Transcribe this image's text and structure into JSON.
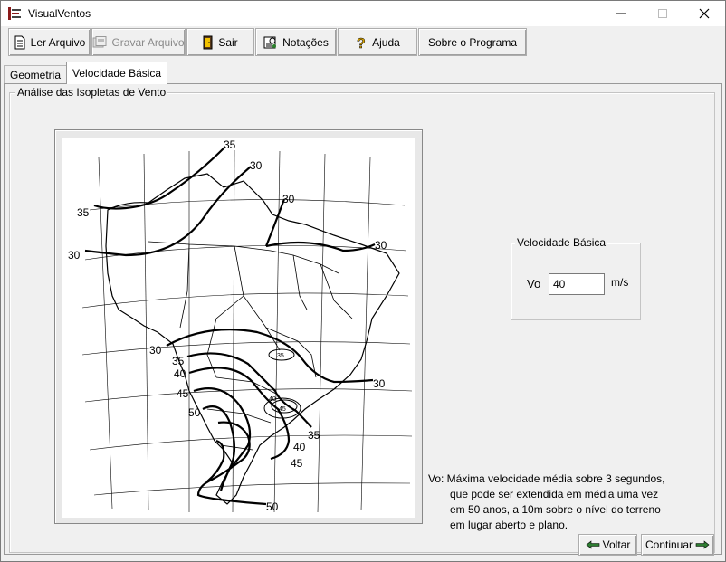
{
  "window": {
    "title": "VisualVentos"
  },
  "toolbar": {
    "buttons": [
      {
        "label": "Ler Arquivo",
        "icon": "document-icon",
        "enabled": true
      },
      {
        "label": "Gravar Arquivo",
        "icon": "save-icon",
        "enabled": false
      },
      {
        "label": "Sair",
        "icon": "exit-door-icon",
        "enabled": true
      },
      {
        "label": "Notações",
        "icon": "notes-icon",
        "enabled": true
      },
      {
        "label": "Ajuda",
        "icon": "help-icon",
        "enabled": true
      },
      {
        "label": "Sobre o Programa",
        "icon": "",
        "enabled": true
      }
    ]
  },
  "tabs": [
    {
      "label": "Geometria",
      "active": false
    },
    {
      "label": "Velocidade Básica",
      "active": true
    }
  ],
  "analysis_group": {
    "title": "Análise das Isopletas de Vento"
  },
  "map": {
    "isopleth_labels": [
      "35",
      "30",
      "35",
      "30",
      "30",
      "30",
      "30",
      "35",
      "40",
      "45",
      "50",
      "35",
      "40",
      "45",
      "50",
      "30",
      "35",
      "40",
      "45"
    ]
  },
  "velocity_group": {
    "title": "Velocidade Básica",
    "field_label": "Vo",
    "value": "40",
    "unit": "m/s"
  },
  "note": {
    "lines": [
      "Vo: Máxima velocidade média sobre 3 segundos,",
      "que pode ser extendida em média uma vez",
      "em 50 anos, a 10m sobre o nível do terreno",
      "em lugar aberto e plano."
    ]
  },
  "navigation": {
    "back_label": "Voltar",
    "continue_label": "Continuar"
  },
  "colors": {
    "window_bg": "#f0f0f0",
    "arrow_green": "#2e7d32"
  }
}
